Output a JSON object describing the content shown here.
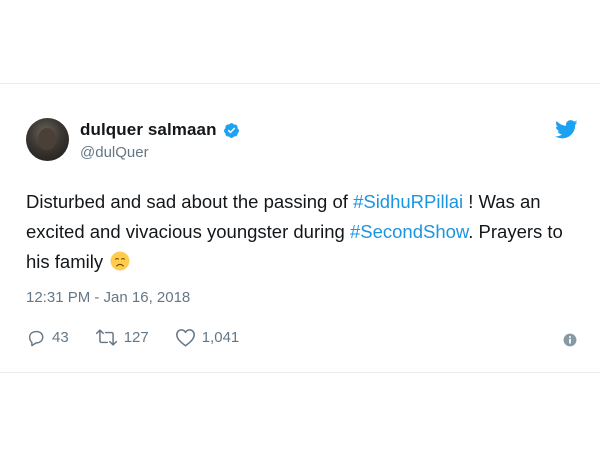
{
  "tweet": {
    "display_name": "dulquer salmaan",
    "handle": "@dulQuer",
    "text_parts": {
      "p1": "Disturbed and sad about the passing of ",
      "hashtag1": "#SidhuRPillai",
      "p2": " ! Was an excited and vivacious youngster during ",
      "hashtag2": "#SecondShow",
      "p3": ". Prayers to his family "
    },
    "timestamp": "12:31 PM - Jan 16, 2018",
    "stats": {
      "replies": "43",
      "retweets": "127",
      "likes": "1,041"
    }
  },
  "icons": {
    "verified": "verified-badge-icon",
    "brand": "twitter-bird-icon",
    "reply": "reply-icon",
    "retweet": "retweet-icon",
    "like": "heart-icon",
    "info": "info-icon",
    "emoji": "disappointed-face-emoji"
  },
  "colors": {
    "brand_blue": "#1da1f2",
    "hashtag_blue": "#1b95e0",
    "text": "#14171a",
    "muted": "#657786",
    "emoji": "#ffcc4d"
  }
}
